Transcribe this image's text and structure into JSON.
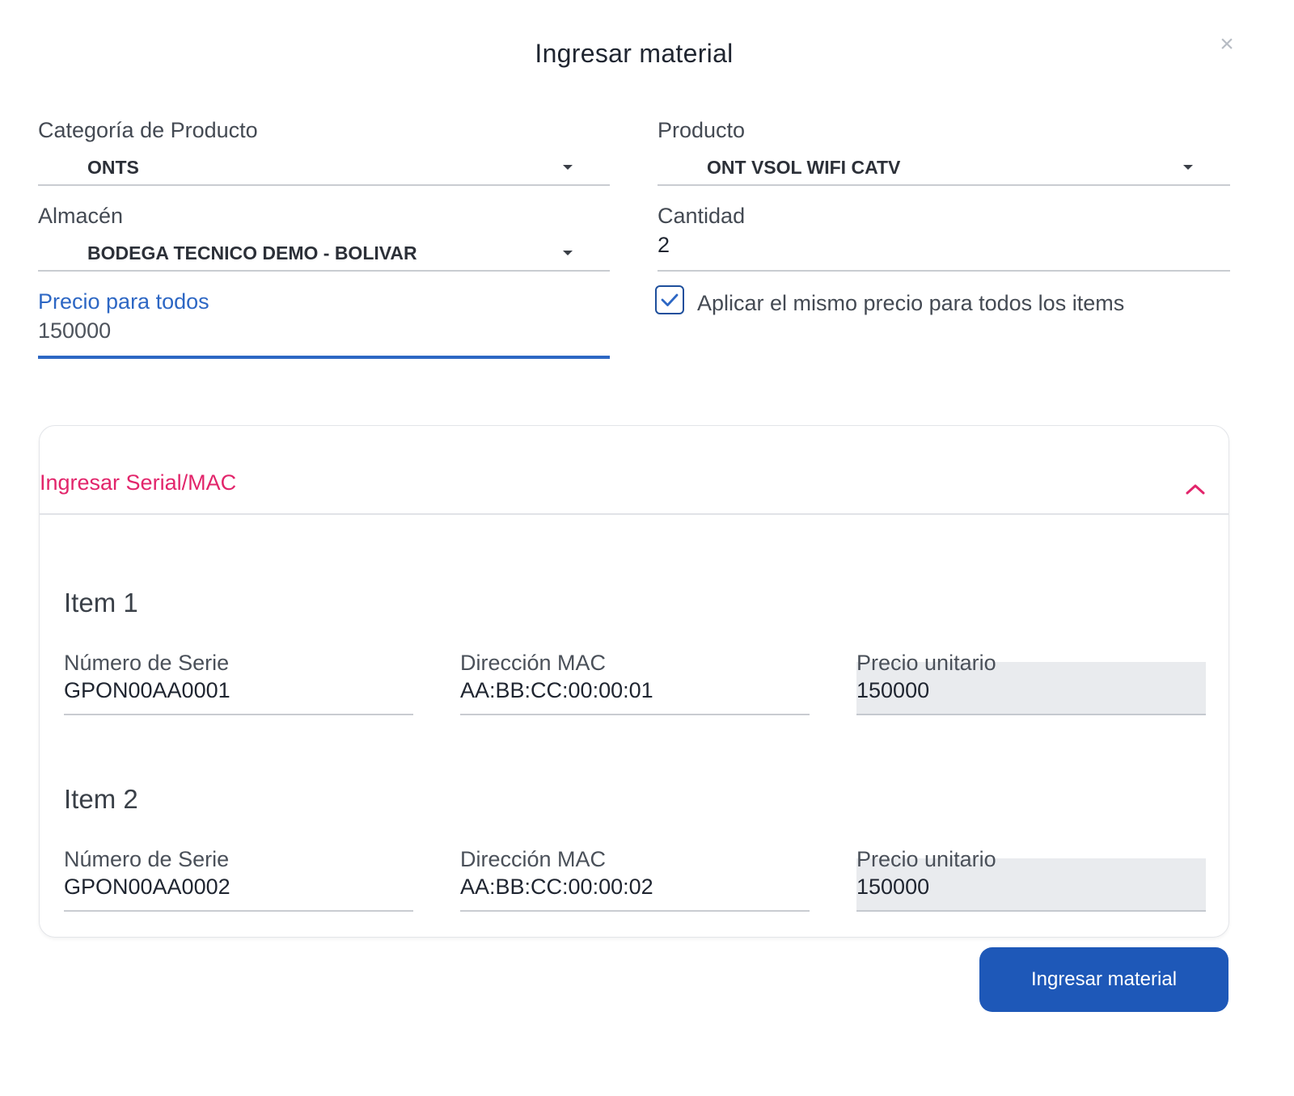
{
  "modal": {
    "title": "Ingresar material",
    "close_icon": "close-icon"
  },
  "form": {
    "categoria": {
      "label": "Categoría de Producto",
      "value": "ONTS"
    },
    "producto": {
      "label": "Producto",
      "value": "ONT VSOL WIFI CATV"
    },
    "almacen": {
      "label": "Almacén",
      "value": "BODEGA TECNICO DEMO - BOLIVAR"
    },
    "cantidad": {
      "label": "Cantidad",
      "value": "2"
    },
    "precio_todos": {
      "label": "Precio para todos",
      "value": "150000"
    },
    "aplicar_mismo_precio": {
      "label": "Aplicar el mismo precio para todos los items",
      "checked": true
    }
  },
  "serial_panel": {
    "title": "Ingresar Serial/MAC",
    "expanded": true,
    "items": [
      {
        "title": "Item 1",
        "serie_label": "Número de Serie",
        "serie": "GPON00AA0001",
        "mac_label": "Dirección MAC",
        "mac": "AA:BB:CC:00:00:01",
        "precio_label": "Precio unitario",
        "precio": "150000"
      },
      {
        "title": "Item 2",
        "serie_label": "Número de Serie",
        "serie": "GPON00AA0002",
        "mac_label": "Dirección MAC",
        "mac": "AA:BB:CC:00:00:02",
        "precio_label": "Precio unitario",
        "precio": "150000"
      }
    ]
  },
  "actions": {
    "submit_label": "Ingresar material"
  },
  "colors": {
    "primary": "#1e58b8",
    "active_field": "#2d67c4",
    "accent": "#e2256b",
    "readonly_bg": "#e9ebee"
  }
}
